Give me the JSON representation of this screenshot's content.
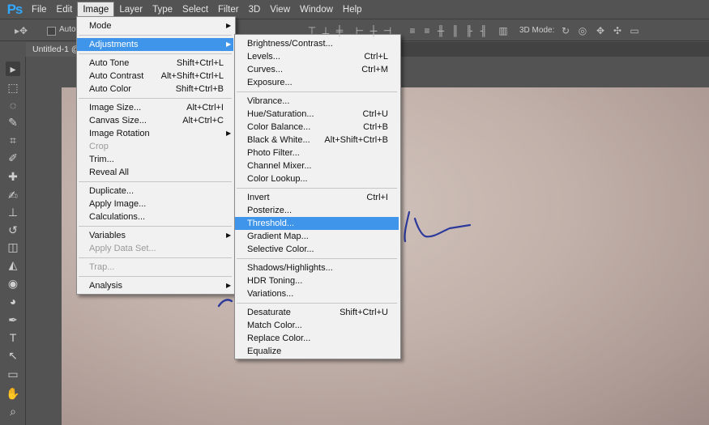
{
  "app": {
    "logo": "Ps"
  },
  "menubar": [
    {
      "label": "File"
    },
    {
      "label": "Edit"
    },
    {
      "label": "Image",
      "active": true
    },
    {
      "label": "Layer"
    },
    {
      "label": "Type"
    },
    {
      "label": "Select"
    },
    {
      "label": "Filter"
    },
    {
      "label": "3D"
    },
    {
      "label": "View"
    },
    {
      "label": "Window"
    },
    {
      "label": "Help"
    }
  ],
  "options": {
    "auto_label": "Auto-",
    "mode_label": "3D Mode:"
  },
  "document": {
    "tab_label": "Untitled-1 @"
  },
  "image_menu": {
    "items": [
      {
        "label": "Mode",
        "submenu": true
      },
      {
        "separator": true
      },
      {
        "label": "Adjustments",
        "submenu": true,
        "highlight": true
      },
      {
        "separator": true
      },
      {
        "label": "Auto Tone",
        "shortcut": "Shift+Ctrl+L"
      },
      {
        "label": "Auto Contrast",
        "shortcut": "Alt+Shift+Ctrl+L"
      },
      {
        "label": "Auto Color",
        "shortcut": "Shift+Ctrl+B"
      },
      {
        "separator": true
      },
      {
        "label": "Image Size...",
        "shortcut": "Alt+Ctrl+I"
      },
      {
        "label": "Canvas Size...",
        "shortcut": "Alt+Ctrl+C"
      },
      {
        "label": "Image Rotation",
        "submenu": true
      },
      {
        "label": "Crop",
        "disabled": true
      },
      {
        "label": "Trim..."
      },
      {
        "label": "Reveal All"
      },
      {
        "separator": true
      },
      {
        "label": "Duplicate..."
      },
      {
        "label": "Apply Image..."
      },
      {
        "label": "Calculations..."
      },
      {
        "separator": true
      },
      {
        "label": "Variables",
        "submenu": true
      },
      {
        "label": "Apply Data Set...",
        "disabled": true
      },
      {
        "separator": true
      },
      {
        "label": "Trap...",
        "disabled": true
      },
      {
        "separator": true
      },
      {
        "label": "Analysis",
        "submenu": true
      }
    ]
  },
  "adjustments_menu": {
    "items": [
      {
        "label": "Brightness/Contrast..."
      },
      {
        "label": "Levels...",
        "shortcut": "Ctrl+L"
      },
      {
        "label": "Curves...",
        "shortcut": "Ctrl+M"
      },
      {
        "label": "Exposure..."
      },
      {
        "separator": true
      },
      {
        "label": "Vibrance..."
      },
      {
        "label": "Hue/Saturation...",
        "shortcut": "Ctrl+U"
      },
      {
        "label": "Color Balance...",
        "shortcut": "Ctrl+B"
      },
      {
        "label": "Black & White...",
        "shortcut": "Alt+Shift+Ctrl+B"
      },
      {
        "label": "Photo Filter..."
      },
      {
        "label": "Channel Mixer..."
      },
      {
        "label": "Color Lookup..."
      },
      {
        "separator": true
      },
      {
        "label": "Invert",
        "shortcut": "Ctrl+I"
      },
      {
        "label": "Posterize..."
      },
      {
        "label": "Threshold...",
        "highlight": true
      },
      {
        "label": "Gradient Map..."
      },
      {
        "label": "Selective Color..."
      },
      {
        "separator": true
      },
      {
        "label": "Shadows/Highlights..."
      },
      {
        "label": "HDR Toning..."
      },
      {
        "label": "Variations..."
      },
      {
        "separator": true
      },
      {
        "label": "Desaturate",
        "shortcut": "Shift+Ctrl+U"
      },
      {
        "label": "Match Color..."
      },
      {
        "label": "Replace Color..."
      },
      {
        "label": "Equalize"
      }
    ]
  },
  "tools": [
    "move-tool-icon",
    "marquee-tool-icon",
    "lasso-tool-icon",
    "quick-select-tool-icon",
    "crop-tool-icon",
    "eyedropper-tool-icon",
    "healing-brush-tool-icon",
    "brush-tool-icon",
    "clone-stamp-tool-icon",
    "history-brush-tool-icon",
    "eraser-tool-icon",
    "paint-bucket-tool-icon",
    "blur-tool-icon",
    "dodge-tool-icon",
    "pen-tool-icon",
    "type-tool-icon",
    "path-select-tool-icon",
    "rectangle-tool-icon",
    "hand-tool-icon",
    "zoom-tool-icon"
  ],
  "colors": {
    "highlight": "#3f95ea",
    "menu_bg": "#f1f1f1",
    "ui_bg": "#535353",
    "logo": "#31a8ff",
    "ink": "#2c3a9c"
  }
}
